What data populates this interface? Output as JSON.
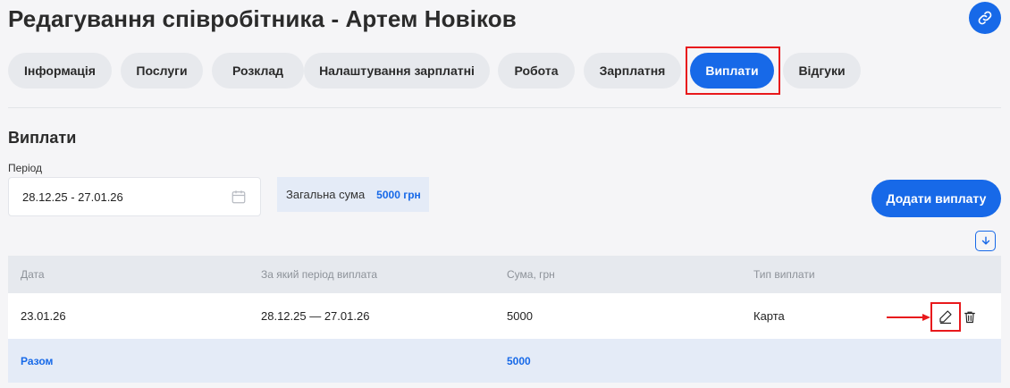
{
  "page": {
    "title": "Редагування співробітника - Артем Новіков"
  },
  "icons": {
    "link": "link-icon",
    "calendar": "calendar-icon",
    "download": "download-icon",
    "edit": "pencil-icon",
    "delete": "trash-icon",
    "annotation_arrow": "arrow-right-icon"
  },
  "colors": {
    "accent": "#1769e8",
    "highlight": "#e8191c",
    "tab_bg": "#e7e9ed",
    "page_bg": "#f5f5f7"
  },
  "tabs": [
    {
      "label": "Інформація"
    },
    {
      "label": "Послуги"
    },
    {
      "label": "Розклад"
    },
    {
      "label": "Налаштування зарплатні"
    },
    {
      "label": "Робота"
    },
    {
      "label": "Зарплатня"
    },
    {
      "label": "Виплати",
      "active": true
    },
    {
      "label": "Відгуки"
    }
  ],
  "payments": {
    "section_title": "Виплати",
    "period_label": "Період",
    "period_value": "28.12.25 - 27.01.26",
    "total_label": "Загальна сума",
    "total_value": "5000 грн",
    "add_button": "Додати виплату"
  },
  "table": {
    "headers": [
      "Дата",
      "За який період виплата",
      "Сума, грн",
      "Тип виплати"
    ],
    "rows": [
      {
        "date": "23.01.26",
        "period": "28.12.25 — 27.01.26",
        "amount": "5000",
        "type": "Карта"
      }
    ],
    "footer": {
      "label": "Разом",
      "amount": "5000"
    }
  }
}
